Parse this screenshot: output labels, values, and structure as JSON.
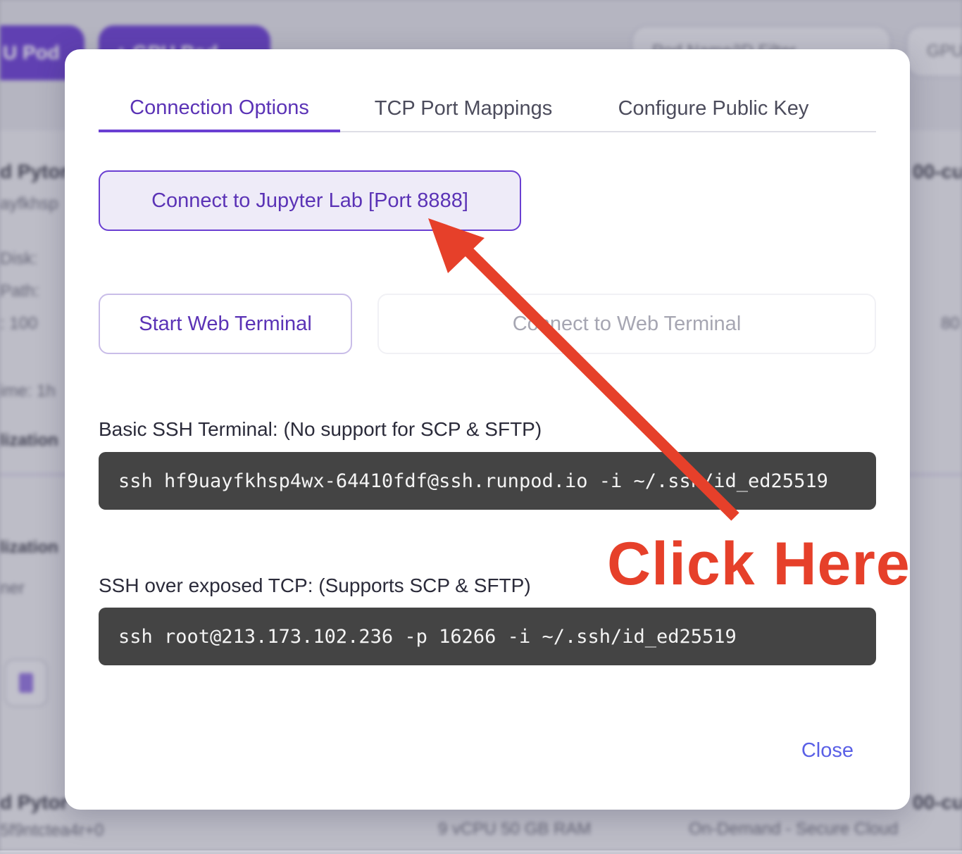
{
  "background": {
    "pills": [
      "U Pod",
      "+ GPU Pod"
    ],
    "filter_placeholder": "Pod Name/ID Filter",
    "gpu_filter": "GPU",
    "rows": [
      {
        "name": "d Pytor",
        "id": "ayfkhsp",
        "right": "00-cu"
      },
      {
        "name": "d Pytor",
        "id": "5f9ntctea4r+0",
        "right": "00-cu"
      }
    ],
    "details": [
      "Disk:",
      "Path:",
      ": 100",
      "ime: 1h",
      "lization",
      "lization",
      "ner"
    ],
    "footer_specs": [
      "9 vCPU 50 GB RAM",
      "On-Demand - Secure Cloud"
    ],
    "side_value": "80"
  },
  "modal": {
    "tabs": [
      "Connection Options",
      "TCP Port Mappings",
      "Configure Public Key"
    ],
    "active_tab": 0,
    "jupyter_button": "Connect to Jupyter Lab [Port 8888]",
    "start_terminal_button": "Start Web Terminal",
    "connect_terminal_button": "Connect to Web Terminal",
    "basic_ssh_label": "Basic SSH Terminal: (No support for SCP & SFTP)",
    "basic_ssh_command": "ssh hf9uayfkhsp4wx-64410fdf@ssh.runpod.io -i ~/.ssh/id_ed25519",
    "tcp_ssh_label": "SSH over exposed TCP: (Supports SCP & SFTP)",
    "tcp_ssh_command": "ssh root@213.173.102.236 -p 16266 -i ~/.ssh/id_ed25519",
    "close_label": "Close"
  },
  "annotation": {
    "text": "Click Here",
    "color": "#e6402a",
    "arrow_target": "jupyter-lab-button"
  },
  "colors": {
    "accent": "#6a3fd2",
    "accent_text": "#5b33b6",
    "command_bg": "#444444",
    "close_link": "#5a60e6"
  }
}
